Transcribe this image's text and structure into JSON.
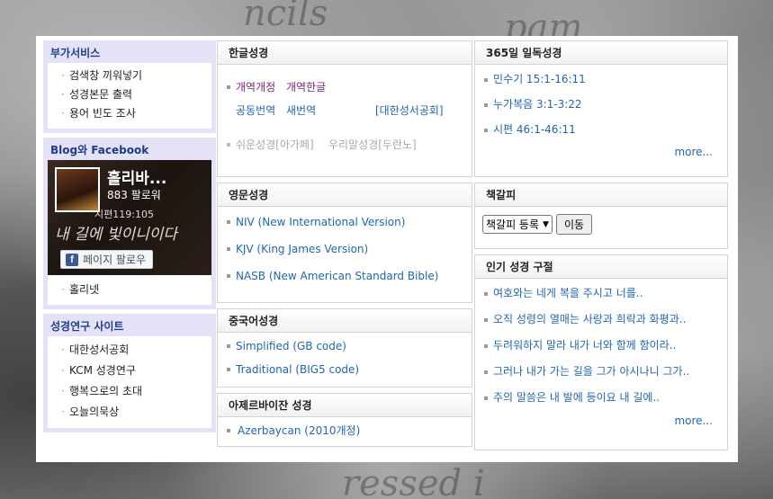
{
  "left": {
    "services": {
      "title": "부가서비스",
      "items": [
        "검색창 끼워넣기",
        "성경본문 출력",
        "용어 빈도 조사"
      ]
    },
    "social": {
      "title": "Blog와 Facebook",
      "fb_name": "홀리바...",
      "fb_followers": "883 팔로워",
      "fb_overlay_text": "내 길에 빛이니이다",
      "fb_overlay_small": "시편119:105",
      "fb_button": "페이지 팔로우",
      "items": [
        "홀리넷"
      ]
    },
    "research": {
      "title": "성경연구 사이트",
      "items": [
        "대한성서공회",
        "KCM 성경연구",
        "행복으로의 초대",
        "오늘의묵상"
      ]
    }
  },
  "middle": {
    "korean": {
      "title": "한글성경",
      "row1": [
        "개역개정",
        "개역한글"
      ],
      "row2": [
        "공동번역",
        "새번역",
        "[대한성서공회]"
      ],
      "row3": [
        "쉬운성경[아가페]",
        "우리말성경[두란노]"
      ]
    },
    "english": {
      "title": "영문성경",
      "items": [
        "NIV (New International Version)",
        "KJV (King James Version)",
        "NASB (New American Standard Bible)"
      ]
    },
    "chinese": {
      "title": "중국어성경",
      "items": [
        "Simplified (GB code)",
        "Traditional (BIG5 code)"
      ]
    },
    "azerbaijani": {
      "title": "아제르바이잔 성경",
      "items": [
        "Azerbaycan (2010개정)"
      ]
    }
  },
  "right": {
    "daily": {
      "title": "365일 일독성경",
      "items": [
        "민수기 15:1-16:11",
        "누가복음 3:1-3:22",
        "시편 46:1-46:11"
      ],
      "more": "more..."
    },
    "bookmark": {
      "title": "책갈피",
      "select_value": "책갈피 등록",
      "button": "이동"
    },
    "popular": {
      "title": "인기 성경 구절",
      "items": [
        "여호와는 네게 복을 주시고 너를..",
        "오직 성령의 열매는 사랑과 희락과 화평과..",
        "두려워하지 말라 내가 너와 함께 함이라..",
        "그러나 내가 가는 길을 그가 아시나니 그가..",
        "주의 말씀은 내 발에 등이요 내 길에.."
      ],
      "more": "more..."
    }
  },
  "colors": {
    "left_box_bg": "#e4e2f6",
    "left_title": "#1f3d8c",
    "link_blue": "#1f66b1",
    "link_purple": "#7a1f7a",
    "link_gray": "#a8a8a8"
  }
}
